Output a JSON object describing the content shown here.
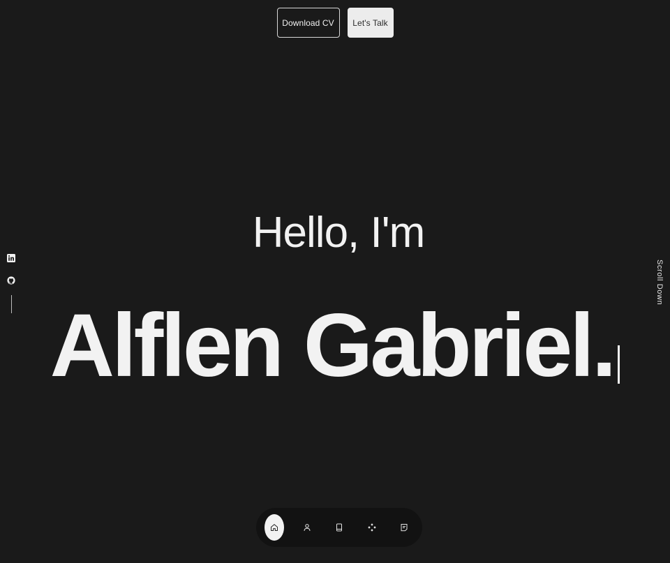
{
  "cta": {
    "download_label": "Download CV",
    "talk_label": "Let's Talk"
  },
  "hero": {
    "greeting": "Hello, I'm",
    "name": "Alflen Gabriel."
  },
  "social": {
    "icons": [
      "linkedin-icon",
      "github-icon"
    ]
  },
  "scroll": {
    "label": "Scroll Down"
  },
  "nav": {
    "items": [
      {
        "icon": "home-icon",
        "active": true
      },
      {
        "icon": "user-icon",
        "active": false
      },
      {
        "icon": "book-icon",
        "active": false
      },
      {
        "icon": "services-icon",
        "active": false
      },
      {
        "icon": "message-icon",
        "active": false
      }
    ]
  },
  "colors": {
    "background": "#1a1a1a",
    "text": "#f2f2f2",
    "nav_background": "#121212",
    "active_pill": "#f2f2f2"
  }
}
